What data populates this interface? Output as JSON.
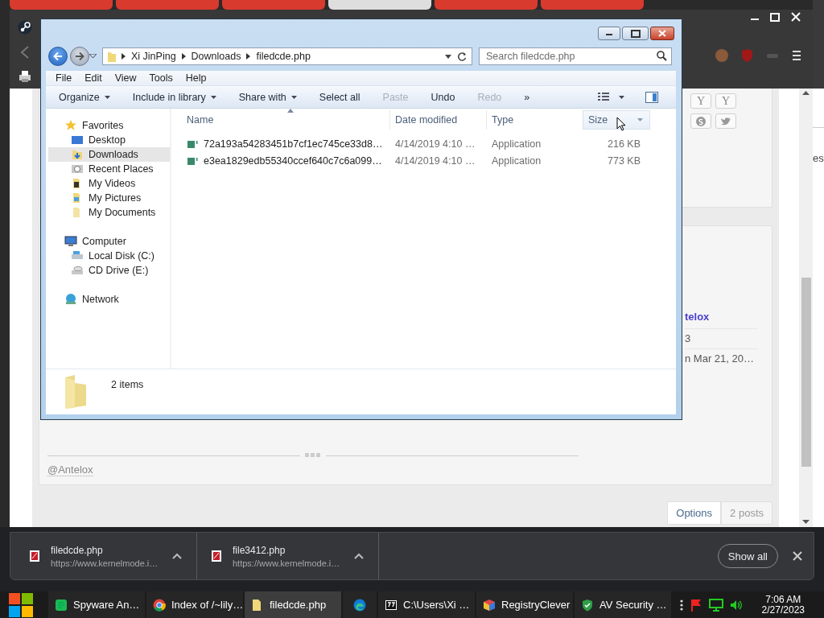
{
  "browser": {
    "tabs": [
      {
        "selected": false
      },
      {
        "selected": false
      },
      {
        "selected": false
      },
      {
        "selected": true
      },
      {
        "selected": false
      },
      {
        "selected": false
      }
    ],
    "page": {
      "social_buttons": [
        {
          "kind": "text",
          "label": "Y"
        },
        {
          "kind": "text",
          "label": "Y"
        },
        {
          "kind": "skype"
        },
        {
          "kind": "twitter"
        }
      ],
      "author": "telox",
      "author_meta": [
        "3",
        "n Mar 21, 20…"
      ],
      "mention": "@Antelox",
      "buttons": [
        {
          "label": "Options",
          "kind": "link"
        },
        {
          "label": "2 posts",
          "kind": "muted"
        }
      ]
    },
    "behind_window_text": "es"
  },
  "explorer": {
    "breadcrumb": [
      "Xi JinPing",
      "Downloads",
      "filedcde.php"
    ],
    "search_placeholder": "Search filedcde.php",
    "menu": [
      "File",
      "Edit",
      "View",
      "Tools",
      "Help"
    ],
    "commands": [
      {
        "label": "Organize",
        "kind": "dropdown",
        "disabled": false
      },
      {
        "label": "Include in library",
        "kind": "dropdown",
        "disabled": false
      },
      {
        "label": "Share with",
        "kind": "dropdown",
        "disabled": false
      },
      {
        "label": "Select all",
        "kind": "button",
        "disabled": false
      },
      {
        "label": "Paste",
        "kind": "button",
        "disabled": true
      },
      {
        "label": "Undo",
        "kind": "button",
        "disabled": false
      },
      {
        "label": "Redo",
        "kind": "button",
        "disabled": true
      },
      {
        "label": "»",
        "kind": "button",
        "disabled": false
      }
    ],
    "nav": [
      {
        "label": "Favorites",
        "kind": "star",
        "selected": false,
        "children": [
          {
            "label": "Desktop",
            "kind": "desktop",
            "selected": false
          },
          {
            "label": "Downloads",
            "kind": "downloads",
            "selected": true
          },
          {
            "label": "Recent Places",
            "kind": "recent",
            "selected": false
          },
          {
            "label": "My Videos",
            "kind": "videos",
            "selected": false
          },
          {
            "label": "My Pictures",
            "kind": "pictures",
            "selected": false
          },
          {
            "label": "My Documents",
            "kind": "documents",
            "selected": false
          }
        ]
      },
      {
        "label": "Computer",
        "kind": "computer",
        "selected": false,
        "children": [
          {
            "label": "Local Disk (C:)",
            "kind": "disk",
            "selected": false
          },
          {
            "label": "CD Drive (E:)",
            "kind": "cd",
            "selected": false
          }
        ]
      },
      {
        "label": "Network",
        "kind": "network",
        "selected": false
      }
    ],
    "columns": [
      {
        "label": "Name",
        "sorted": true,
        "hovered": false
      },
      {
        "label": "Date modified",
        "sorted": false,
        "hovered": false
      },
      {
        "label": "Type",
        "sorted": false,
        "hovered": false
      },
      {
        "label": "Size",
        "sorted": false,
        "hovered": true
      }
    ],
    "files": [
      {
        "name": "72a193a54283451b7cf1ec745ce33d8…",
        "date": "4/14/2019 4:10 …",
        "type": "Application",
        "size": "216 KB"
      },
      {
        "name": "e3ea1829edb55340ccef640c7c6a099…",
        "date": "4/14/2019 4:10 …",
        "type": "Application",
        "size": "773 KB"
      }
    ],
    "status": "2 items"
  },
  "downloads": {
    "items": [
      {
        "name": "filedcde.php",
        "url": "https://www.kernelmode.i…"
      },
      {
        "name": "file3412.php",
        "url": "https://www.kernelmode.i…"
      }
    ],
    "show_all": "Show all"
  },
  "taskbar": {
    "apps": [
      {
        "label": "Spyware An…",
        "kind": "note",
        "selected": false
      },
      {
        "label": "Index of /~lily…",
        "kind": "chrome",
        "selected": false
      },
      {
        "label": "filedcde.php",
        "kind": "folder",
        "selected": true
      },
      {
        "kind": "edge",
        "selected": false
      },
      {
        "label": "C:\\Users\\Xi …",
        "kind": "archive",
        "selected": false
      },
      {
        "label": "RegistryClever",
        "kind": "cube",
        "selected": false
      },
      {
        "label": "AV Security …",
        "kind": "shield",
        "selected": false
      }
    ],
    "time": "7:06 AM",
    "date": "2/27/2023"
  }
}
